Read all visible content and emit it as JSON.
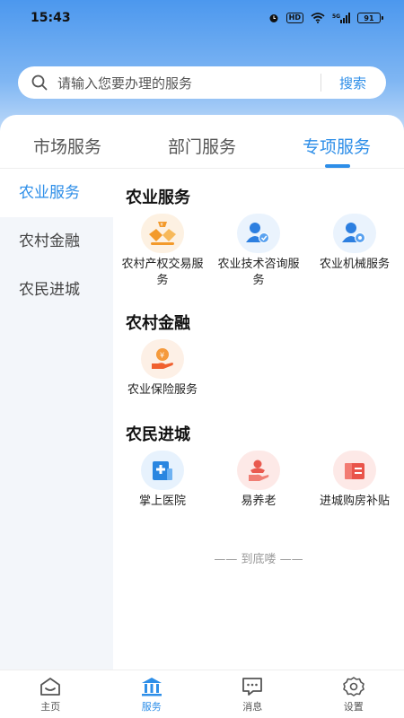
{
  "status_bar": {
    "time": "15:43",
    "network": "5G",
    "battery": "91",
    "hd": "HD"
  },
  "search": {
    "placeholder": "请输入您要办理的服务",
    "button_label": "搜索"
  },
  "tabs": [
    {
      "label": "市场服务",
      "active": false
    },
    {
      "label": "部门服务",
      "active": false
    },
    {
      "label": "专项服务",
      "active": true
    }
  ],
  "sidebar": {
    "items": [
      {
        "label": "农业服务",
        "active": true
      },
      {
        "label": "农村金融",
        "active": false
      },
      {
        "label": "农民进城",
        "active": false
      }
    ]
  },
  "sections": [
    {
      "title": "农业服务",
      "items": [
        {
          "label": "农村产权交易服务",
          "icon": "property-trade-icon"
        },
        {
          "label": "农业技术咨询服务",
          "icon": "tech-consult-icon"
        },
        {
          "label": "农业机械服务",
          "icon": "machinery-service-icon"
        }
      ]
    },
    {
      "title": "农村金融",
      "items": [
        {
          "label": "农业保险服务",
          "icon": "insurance-icon"
        }
      ]
    },
    {
      "title": "农民进城",
      "items": [
        {
          "label": "掌上医院",
          "icon": "hospital-icon"
        },
        {
          "label": "易养老",
          "icon": "elderly-care-icon"
        },
        {
          "label": "进城购房补贴",
          "icon": "housing-subsidy-icon"
        }
      ]
    }
  ],
  "end_hint": "—— 到底喽 ——",
  "bottom_nav": [
    {
      "label": "主页",
      "icon": "home-icon",
      "active": false
    },
    {
      "label": "服务",
      "icon": "bank-icon",
      "active": true
    },
    {
      "label": "消息",
      "icon": "message-icon",
      "active": false
    },
    {
      "label": "设置",
      "icon": "gear-icon",
      "active": false
    }
  ],
  "colors": {
    "accent": "#2d8ee8",
    "orange": "#f39a2b",
    "red": "#e95a4f"
  }
}
